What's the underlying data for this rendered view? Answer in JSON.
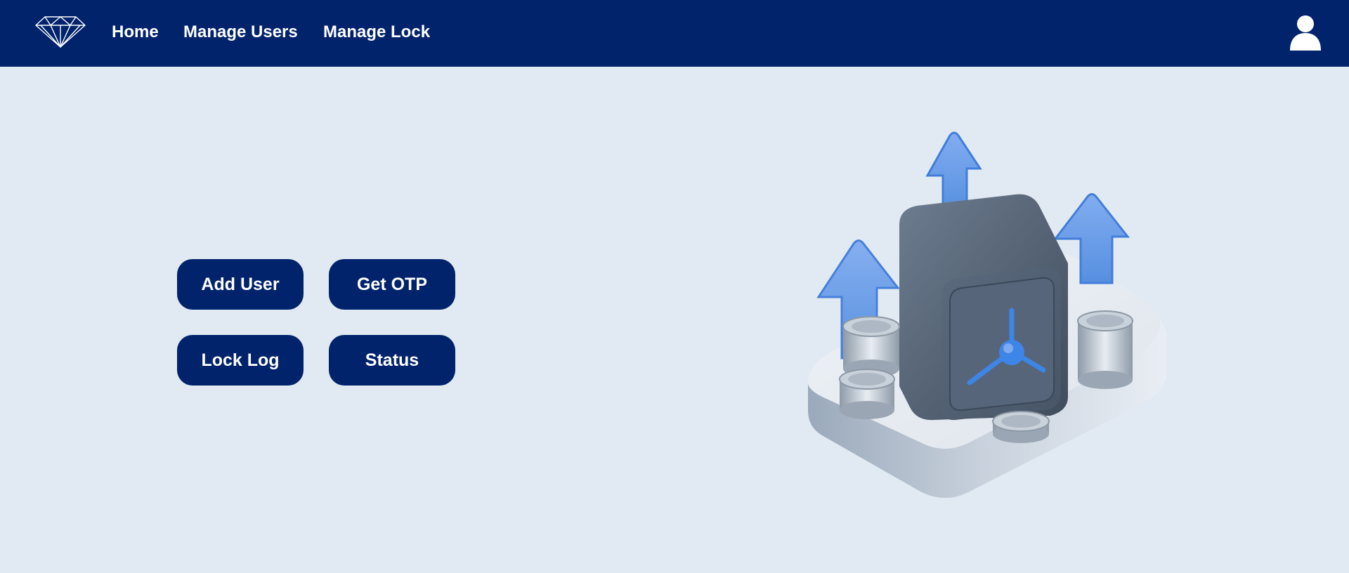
{
  "nav": {
    "logo_icon": "diamond-icon",
    "links": [
      {
        "label": "Home"
      },
      {
        "label": "Manage Users"
      },
      {
        "label": "Manage Lock"
      }
    ],
    "user_icon": "user-avatar-icon",
    "background": "#00236c"
  },
  "actions": {
    "add_user": "Add User",
    "get_otp": "Get OTP",
    "lock_log": "Lock Log",
    "status": "Status"
  },
  "illustration": {
    "icon": "safe-with-coins-and-arrows-illustration"
  },
  "colors": {
    "page_background": "#e1eaf2",
    "primary": "#00236c",
    "accent": "#3d85e6"
  }
}
